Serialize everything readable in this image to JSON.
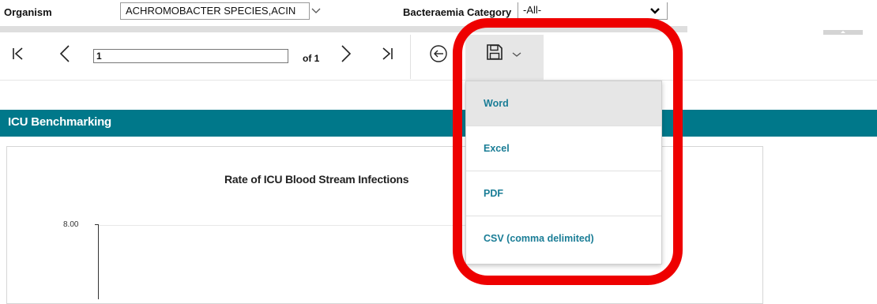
{
  "parameters": {
    "organism": {
      "label": "Organism",
      "value": "ACHROMOBACTER SPECIES,ACIN"
    },
    "bacteraemia": {
      "label": "Bacteraemia Category",
      "value": "-All-"
    }
  },
  "toolbar": {
    "page_number": "1",
    "of_label": "of 1"
  },
  "report": {
    "title": "ICU Benchmarking",
    "chart_data": {
      "type": "bar",
      "title": "Rate of ICU Blood Stream Infections",
      "y_ticks": [
        "8.00"
      ],
      "ylim": [
        0,
        8
      ],
      "categories": [],
      "series": []
    }
  },
  "export_menu": {
    "items": [
      {
        "label": "Word",
        "hover": true
      },
      {
        "label": "Excel",
        "hover": false
      },
      {
        "label": "PDF",
        "hover": false
      },
      {
        "label": "CSV (comma delimited)",
        "hover": false
      }
    ]
  },
  "colors": {
    "report_band": "#00788a",
    "menu_text": "#1a7d96",
    "highlight": "#ee0000"
  }
}
